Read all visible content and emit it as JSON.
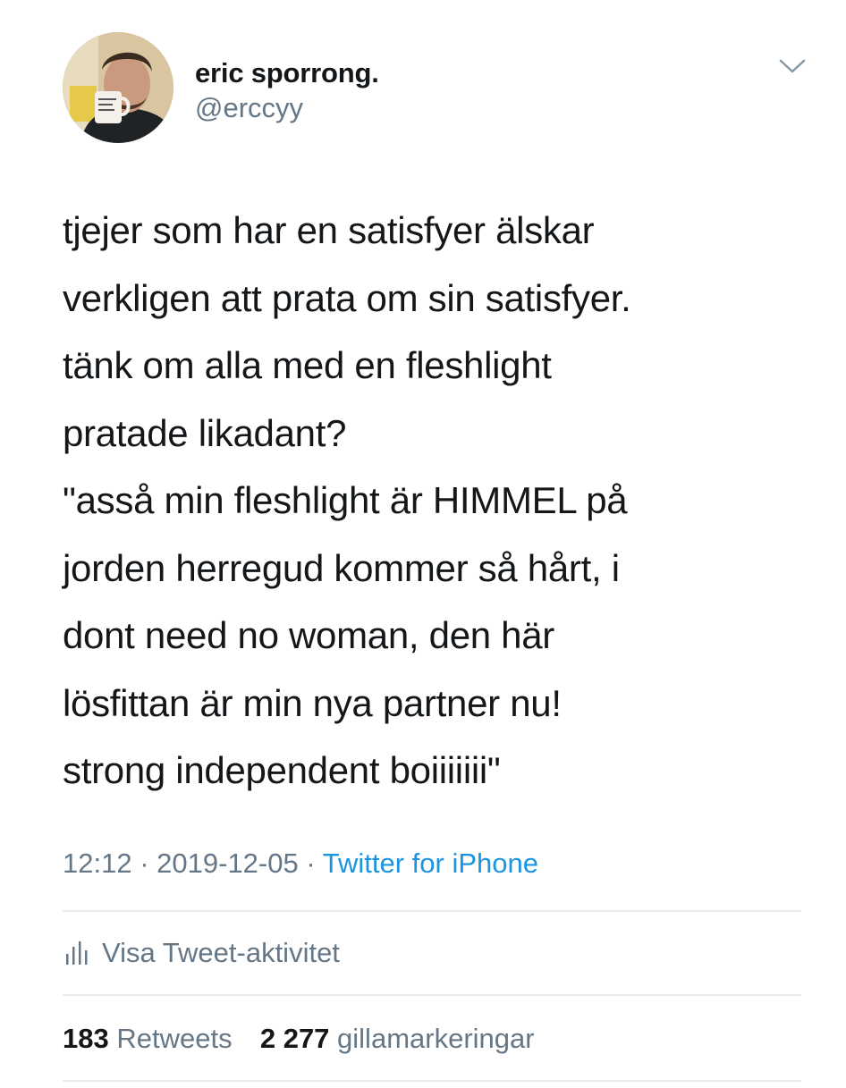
{
  "author": {
    "display_name": "eric sporrong.",
    "handle": "@erccyy"
  },
  "icons": {
    "chevron": "chevron-down-icon",
    "activity": "bar-chart-icon"
  },
  "tweet": {
    "lines": [
      "tjejer som har en satisfyer älskar",
      "verkligen att prata om sin satisfyer.",
      "tänk om alla med en fleshlight",
      "pratade likadant?",
      "\"asså min fleshlight är HIMMEL på",
      "jorden herregud kommer så hårt, i",
      "dont need no woman, den här",
      "lösfittan är min nya partner nu!",
      "strong independent boiiiiiii\""
    ]
  },
  "meta": {
    "time": "12:12",
    "separator": "·",
    "date": "2019-12-05",
    "source": "Twitter for iPhone"
  },
  "activity": {
    "label": "Visa Tweet-aktivitet"
  },
  "stats": {
    "retweets_count": "183",
    "retweets_label": "Retweets",
    "likes_count": "2 277",
    "likes_label": "gillamarkeringar"
  },
  "colors": {
    "text": "#14171a",
    "secondary": "#657786",
    "link": "#1b95e0",
    "divider": "#e6ecf0"
  }
}
